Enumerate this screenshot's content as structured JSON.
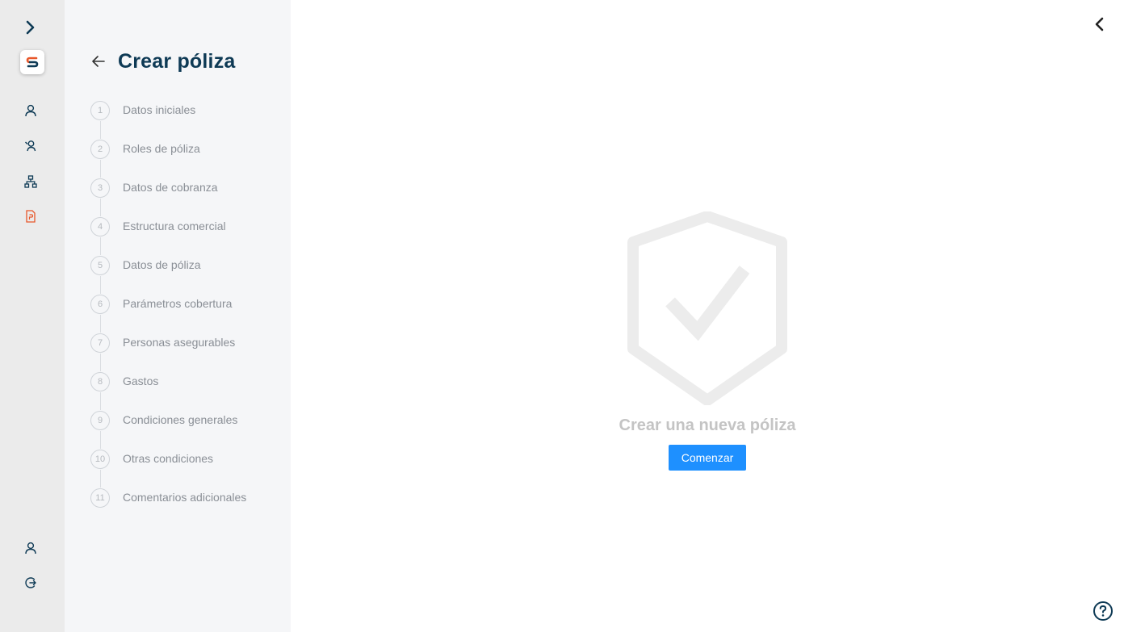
{
  "rail": {
    "icons": [
      "expand-chevron-icon",
      "app-logo",
      "user-icon",
      "users-search-icon",
      "org-chart-icon",
      "policy-document-icon",
      "account-icon",
      "logout-icon"
    ],
    "active_color": "#e8572a",
    "icon_color": "#0e3a55"
  },
  "panel": {
    "title": "Crear póliza",
    "steps": [
      {
        "num": "1",
        "label": "Datos iniciales"
      },
      {
        "num": "2",
        "label": "Roles de póliza"
      },
      {
        "num": "3",
        "label": "Datos de cobranza"
      },
      {
        "num": "4",
        "label": "Estructura comercial"
      },
      {
        "num": "5",
        "label": "Datos de póliza"
      },
      {
        "num": "6",
        "label": "Parámetros cobertura"
      },
      {
        "num": "7",
        "label": "Personas asegurables"
      },
      {
        "num": "8",
        "label": "Gastos"
      },
      {
        "num": "9",
        "label": "Condiciones generales"
      },
      {
        "num": "10",
        "label": "Otras condiciones"
      },
      {
        "num": "11",
        "label": "Comentarios adicionales"
      }
    ]
  },
  "main": {
    "empty_title": "Crear una nueva póliza",
    "start_label": "Comenzar",
    "accent": "#1e90ff"
  }
}
